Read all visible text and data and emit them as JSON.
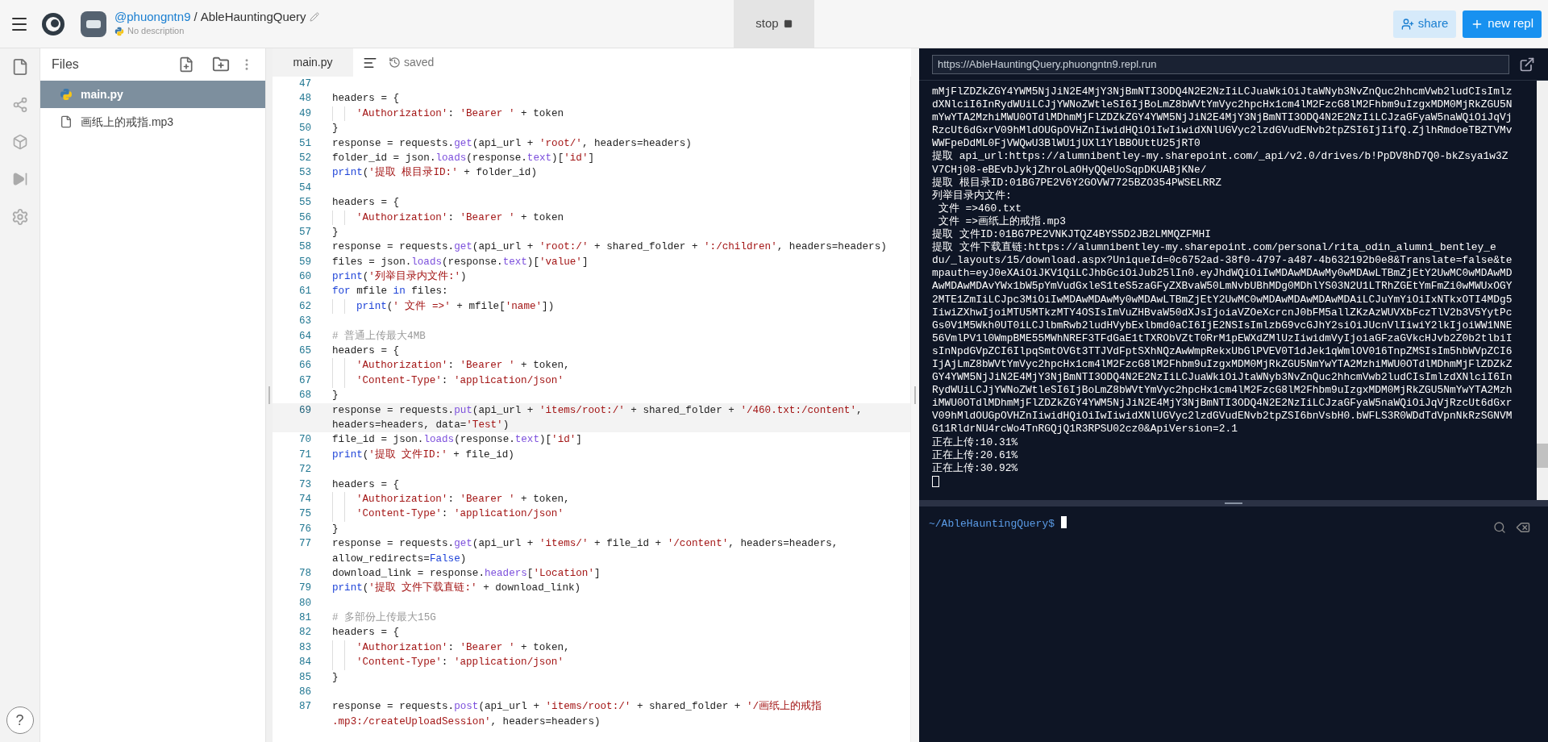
{
  "header": {
    "user": "@phuongntn9",
    "separator": "/",
    "repl_name": "AbleHauntingQuery",
    "description": "No description",
    "stop_button": "stop",
    "share_button": "share",
    "new_repl_button": "new repl"
  },
  "sidebar": {
    "help_button": "?"
  },
  "files": {
    "title": "Files",
    "items": [
      {
        "name": "main.py",
        "kind": "python",
        "selected": true
      },
      {
        "name": "画纸上的戒指.mp3",
        "kind": "file",
        "selected": false
      }
    ]
  },
  "editor": {
    "tab": "main.py",
    "status": "saved",
    "lines": [
      {
        "number": "47",
        "indented": false,
        "current": false
      },
      {
        "number": "48",
        "indented": false,
        "current": false,
        "rows": [
          {
            "segments": [
              {
                "text": "headers = {",
                "kind": "plain"
              }
            ]
          }
        ]
      },
      {
        "number": "49",
        "indented": true,
        "current": false,
        "rows": [
          {
            "segments": [
              {
                "text": "'Authorization'",
                "kind": "string"
              },
              {
                "text": ": ",
                "kind": "plain"
              },
              {
                "text": "'Bearer '",
                "kind": "string"
              },
              {
                "text": " + token",
                "kind": "plain"
              }
            ]
          }
        ]
      },
      {
        "number": "50",
        "indented": false,
        "current": false,
        "rows": [
          {
            "segments": [
              {
                "text": "}",
                "kind": "plain"
              }
            ]
          }
        ]
      },
      {
        "number": "51",
        "indented": false,
        "current": false,
        "rows": [
          {
            "segments": [
              {
                "text": "response = requests.",
                "kind": "plain"
              },
              {
                "text": "get",
                "kind": "member"
              },
              {
                "text": "(api_url + ",
                "kind": "plain"
              },
              {
                "text": "'root/'",
                "kind": "string"
              },
              {
                "text": ", headers=headers)",
                "kind": "plain"
              }
            ]
          }
        ]
      },
      {
        "number": "52",
        "indented": false,
        "current": false,
        "rows": [
          {
            "segments": [
              {
                "text": "folder_id = json.",
                "kind": "plain"
              },
              {
                "text": "loads",
                "kind": "member"
              },
              {
                "text": "(response.",
                "kind": "plain"
              },
              {
                "text": "text",
                "kind": "member"
              },
              {
                "text": ")[",
                "kind": "plain"
              },
              {
                "text": "'id'",
                "kind": "string"
              },
              {
                "text": "]",
                "kind": "plain"
              }
            ]
          }
        ]
      },
      {
        "number": "53",
        "indented": false,
        "current": false,
        "rows": [
          {
            "segments": [
              {
                "text": "print",
                "kind": "keyword"
              },
              {
                "text": "(",
                "kind": "plain"
              },
              {
                "text": "'提取 根目录ID:'",
                "kind": "string"
              },
              {
                "text": " + folder_id)",
                "kind": "plain"
              }
            ]
          }
        ]
      },
      {
        "number": "54",
        "indented": false,
        "current": false
      },
      {
        "number": "55",
        "indented": false,
        "current": false,
        "rows": [
          {
            "segments": [
              {
                "text": "headers = {",
                "kind": "plain"
              }
            ]
          }
        ]
      },
      {
        "number": "56",
        "indented": true,
        "current": false,
        "rows": [
          {
            "segments": [
              {
                "text": "'Authorization'",
                "kind": "string"
              },
              {
                "text": ": ",
                "kind": "plain"
              },
              {
                "text": "'Bearer '",
                "kind": "string"
              },
              {
                "text": " + token",
                "kind": "plain"
              }
            ]
          }
        ]
      },
      {
        "number": "57",
        "indented": false,
        "current": false,
        "rows": [
          {
            "segments": [
              {
                "text": "}",
                "kind": "plain"
              }
            ]
          }
        ]
      },
      {
        "number": "58",
        "indented": false,
        "current": false,
        "rows": [
          {
            "segments": [
              {
                "text": "response = requests.",
                "kind": "plain"
              },
              {
                "text": "get",
                "kind": "member"
              },
              {
                "text": "(api_url + ",
                "kind": "plain"
              },
              {
                "text": "'root:/'",
                "kind": "string"
              },
              {
                "text": " + shared_folder + ",
                "kind": "plain"
              },
              {
                "text": "':/children'",
                "kind": "string"
              },
              {
                "text": ", headers=headers)",
                "kind": "plain"
              }
            ]
          }
        ]
      },
      {
        "number": "59",
        "indented": false,
        "current": false,
        "rows": [
          {
            "segments": [
              {
                "text": "files = json.",
                "kind": "plain"
              },
              {
                "text": "loads",
                "kind": "member"
              },
              {
                "text": "(response.",
                "kind": "plain"
              },
              {
                "text": "text",
                "kind": "member"
              },
              {
                "text": ")[",
                "kind": "plain"
              },
              {
                "text": "'value'",
                "kind": "string"
              },
              {
                "text": "]",
                "kind": "plain"
              }
            ]
          }
        ]
      },
      {
        "number": "60",
        "indented": false,
        "current": false,
        "rows": [
          {
            "segments": [
              {
                "text": "print",
                "kind": "keyword"
              },
              {
                "text": "(",
                "kind": "plain"
              },
              {
                "text": "'列举目录内文件:'",
                "kind": "string"
              },
              {
                "text": ")",
                "kind": "plain"
              }
            ]
          }
        ]
      },
      {
        "number": "61",
        "indented": false,
        "current": false,
        "rows": [
          {
            "segments": [
              {
                "text": "for",
                "kind": "keyword"
              },
              {
                "text": " mfile ",
                "kind": "plain"
              },
              {
                "text": "in",
                "kind": "keyword"
              },
              {
                "text": " files:",
                "kind": "plain"
              }
            ]
          }
        ]
      },
      {
        "number": "62",
        "indented": true,
        "current": false,
        "rows": [
          {
            "segments": [
              {
                "text": "print",
                "kind": "keyword"
              },
              {
                "text": "(",
                "kind": "plain"
              },
              {
                "text": "' 文件 =>'",
                "kind": "string"
              },
              {
                "text": " + mfile[",
                "kind": "plain"
              },
              {
                "text": "'name'",
                "kind": "string"
              },
              {
                "text": "])",
                "kind": "plain"
              }
            ]
          }
        ]
      },
      {
        "number": "63",
        "indented": false,
        "current": false
      },
      {
        "number": "64",
        "indented": false,
        "current": false,
        "rows": [
          {
            "segments": [
              {
                "text": "# 普通上传最大4MB",
                "kind": "comment"
              }
            ]
          }
        ]
      },
      {
        "number": "65",
        "indented": false,
        "current": false,
        "rows": [
          {
            "segments": [
              {
                "text": "headers = {",
                "kind": "plain"
              }
            ]
          }
        ]
      },
      {
        "number": "66",
        "indented": true,
        "current": false,
        "rows": [
          {
            "segments": [
              {
                "text": "'Authorization'",
                "kind": "string"
              },
              {
                "text": ": ",
                "kind": "plain"
              },
              {
                "text": "'Bearer '",
                "kind": "string"
              },
              {
                "text": " + token,",
                "kind": "plain"
              }
            ]
          }
        ]
      },
      {
        "number": "67",
        "indented": true,
        "current": false,
        "rows": [
          {
            "segments": [
              {
                "text": "'Content-Type'",
                "kind": "string"
              },
              {
                "text": ": ",
                "kind": "plain"
              },
              {
                "text": "'application/json'",
                "kind": "string"
              }
            ]
          }
        ]
      },
      {
        "number": "68",
        "indented": false,
        "current": false,
        "rows": [
          {
            "segments": [
              {
                "text": "}",
                "kind": "plain"
              }
            ]
          }
        ]
      },
      {
        "number": "69",
        "indented": false,
        "current": true,
        "rows": [
          {
            "segments": [
              {
                "text": "response = requests.",
                "kind": "plain"
              },
              {
                "text": "put",
                "kind": "member"
              },
              {
                "text": "(api_url + ",
                "kind": "plain"
              },
              {
                "text": "'items/root:/'",
                "kind": "string"
              },
              {
                "text": " + shared_folder + ",
                "kind": "plain"
              },
              {
                "text": "'/460.txt:/content'",
                "kind": "string"
              },
              {
                "text": ",",
                "kind": "plain"
              }
            ]
          },
          {
            "segments": [
              {
                "text": "headers=headers, data=",
                "kind": "plain"
              },
              {
                "text": "'Test'",
                "kind": "string"
              },
              {
                "text": ")",
                "kind": "plain"
              }
            ]
          }
        ]
      },
      {
        "number": "70",
        "indented": false,
        "current": false,
        "rows": [
          {
            "segments": [
              {
                "text": "file_id = json.",
                "kind": "plain"
              },
              {
                "text": "loads",
                "kind": "member"
              },
              {
                "text": "(response.",
                "kind": "plain"
              },
              {
                "text": "text",
                "kind": "member"
              },
              {
                "text": ")[",
                "kind": "plain"
              },
              {
                "text": "'id'",
                "kind": "string"
              },
              {
                "text": "]",
                "kind": "plain"
              }
            ]
          }
        ]
      },
      {
        "number": "71",
        "indented": false,
        "current": false,
        "rows": [
          {
            "segments": [
              {
                "text": "print",
                "kind": "keyword"
              },
              {
                "text": "(",
                "kind": "plain"
              },
              {
                "text": "'提取 文件ID:'",
                "kind": "string"
              },
              {
                "text": " + file_id)",
                "kind": "plain"
              }
            ]
          }
        ]
      },
      {
        "number": "72",
        "indented": false,
        "current": false
      },
      {
        "number": "73",
        "indented": false,
        "current": false,
        "rows": [
          {
            "segments": [
              {
                "text": "headers = {",
                "kind": "plain"
              }
            ]
          }
        ]
      },
      {
        "number": "74",
        "indented": true,
        "current": false,
        "rows": [
          {
            "segments": [
              {
                "text": "'Authorization'",
                "kind": "string"
              },
              {
                "text": ": ",
                "kind": "plain"
              },
              {
                "text": "'Bearer '",
                "kind": "string"
              },
              {
                "text": " + token,",
                "kind": "plain"
              }
            ]
          }
        ]
      },
      {
        "number": "75",
        "indented": true,
        "current": false,
        "rows": [
          {
            "segments": [
              {
                "text": "'Content-Type'",
                "kind": "string"
              },
              {
                "text": ": ",
                "kind": "plain"
              },
              {
                "text": "'application/json'",
                "kind": "string"
              }
            ]
          }
        ]
      },
      {
        "number": "76",
        "indented": false,
        "current": false,
        "rows": [
          {
            "segments": [
              {
                "text": "}",
                "kind": "plain"
              }
            ]
          }
        ]
      },
      {
        "number": "77",
        "indented": false,
        "current": false,
        "rows": [
          {
            "segments": [
              {
                "text": "response = requests.",
                "kind": "plain"
              },
              {
                "text": "get",
                "kind": "member"
              },
              {
                "text": "(api_url + ",
                "kind": "plain"
              },
              {
                "text": "'items/'",
                "kind": "string"
              },
              {
                "text": " + file_id + ",
                "kind": "plain"
              },
              {
                "text": "'/content'",
                "kind": "string"
              },
              {
                "text": ", headers=headers,",
                "kind": "plain"
              }
            ]
          },
          {
            "segments": [
              {
                "text": "allow_redirects=",
                "kind": "plain"
              },
              {
                "text": "False",
                "kind": "keyword"
              },
              {
                "text": ")",
                "kind": "plain"
              }
            ]
          }
        ]
      },
      {
        "number": "78",
        "indented": false,
        "current": false,
        "rows": [
          {
            "segments": [
              {
                "text": "download_link = response.",
                "kind": "plain"
              },
              {
                "text": "headers",
                "kind": "member"
              },
              {
                "text": "[",
                "kind": "plain"
              },
              {
                "text": "'Location'",
                "kind": "string"
              },
              {
                "text": "]",
                "kind": "plain"
              }
            ]
          }
        ]
      },
      {
        "number": "79",
        "indented": false,
        "current": false,
        "rows": [
          {
            "segments": [
              {
                "text": "print",
                "kind": "keyword"
              },
              {
                "text": "(",
                "kind": "plain"
              },
              {
                "text": "'提取 文件下载直链:'",
                "kind": "string"
              },
              {
                "text": " + download_link)",
                "kind": "plain"
              }
            ]
          }
        ]
      },
      {
        "number": "80",
        "indented": false,
        "current": false
      },
      {
        "number": "81",
        "indented": false,
        "current": false,
        "rows": [
          {
            "segments": [
              {
                "text": "# 多部份上传最大15G",
                "kind": "comment"
              }
            ]
          }
        ]
      },
      {
        "number": "82",
        "indented": false,
        "current": false,
        "rows": [
          {
            "segments": [
              {
                "text": "headers = {",
                "kind": "plain"
              }
            ]
          }
        ]
      },
      {
        "number": "83",
        "indented": true,
        "current": false,
        "rows": [
          {
            "segments": [
              {
                "text": "'Authorization'",
                "kind": "string"
              },
              {
                "text": ": ",
                "kind": "plain"
              },
              {
                "text": "'Bearer '",
                "kind": "string"
              },
              {
                "text": " + token,",
                "kind": "plain"
              }
            ]
          }
        ]
      },
      {
        "number": "84",
        "indented": true,
        "current": false,
        "rows": [
          {
            "segments": [
              {
                "text": "'Content-Type'",
                "kind": "string"
              },
              {
                "text": ": ",
                "kind": "plain"
              },
              {
                "text": "'application/json'",
                "kind": "string"
              }
            ]
          }
        ]
      },
      {
        "number": "85",
        "indented": false,
        "current": false,
        "rows": [
          {
            "segments": [
              {
                "text": "}",
                "kind": "plain"
              }
            ]
          }
        ]
      },
      {
        "number": "86",
        "indented": false,
        "current": false
      },
      {
        "number": "87",
        "indented": false,
        "current": false,
        "rows": [
          {
            "segments": [
              {
                "text": "response = requests.",
                "kind": "plain"
              },
              {
                "text": "post",
                "kind": "member"
              },
              {
                "text": "(api_url + ",
                "kind": "plain"
              },
              {
                "text": "'items/root:/'",
                "kind": "string"
              },
              {
                "text": " + shared_folder + ",
                "kind": "plain"
              },
              {
                "text": "'/画纸上的戒指",
                "kind": "string"
              }
            ]
          },
          {
            "segments": [
              {
                "text": ".mp3:/createUploadSession'",
                "kind": "string"
              },
              {
                "text": ", headers=headers)",
                "kind": "plain"
              }
            ]
          }
        ]
      }
    ]
  },
  "webview": {
    "url": "https://AbleHauntingQuery.phuongntn9.repl.run"
  },
  "console": {
    "lines": [
      "mMjFlZDZkZGY4YWM5NjJiN2E4MjY3NjBmNTI3ODQ4N2E2NzIiLCJuaWkiOiJtaWNyb3NvZnQuc2hhcmVwb2ludCIsImlz",
      "dXNlciI6InRydWUiLCJjYWNoZWtleSI6IjBoLmZ8bWVtYmVyc2hpcHx1cm4lM2FzcG8lM2Fhbm9uIzgxMDM0MjRkZGU5N",
      "mYwYTA2MzhiMWU0OTdlMDhmMjFlZDZkZGY4YWM5NjJiN2E4MjY3NjBmNTI3ODQ4N2E2NzIiLCJzaGFyaW5naWQiOiJqVj",
      "RzcUt6dGxrV09hMldOUGpOVHZnIiwidHQiOiIwIiwidXNlUGVyc2lzdGVudENvb2tpZSI6IjIifQ.ZjlhRmdoeTBZTVMv",
      "WWFpeDdML0FjVWQwU3BlWU1jUXl1YlBBOUttU25jRT0",
      "提取 api_url:https://alumnibentley-my.sharepoint.com/_api/v2.0/drives/b!PpDV8hD7Q0-bkZsya1w3Z",
      "V7CHj08-eBEvbJykjZhroLaOHyQQeUoSqpDKUABjKNe/",
      "提取 根目录ID:01BG7PE2V6Y2GOVW7725BZO354PWSELRRZ",
      "列举目录内文件:",
      " 文件 =>460.txt",
      " 文件 =>画纸上的戒指.mp3",
      "提取 文件ID:01BG7PE2VNKJTQZ4BYS5D2JB2LMMQZFMHI",
      "提取 文件下载直链:https://alumnibentley-my.sharepoint.com/personal/rita_odin_alumni_bentley_e",
      "du/_layouts/15/download.aspx?UniqueId=0c6752ad-38f0-4797-a487-4b632192b0e8&Translate=false&te",
      "mpauth=eyJ0eXAiOiJKV1QiLCJhbGciOiJub25lIn0.eyJhdWQiOiIwMDAwMDAwMy0wMDAwLTBmZjEtY2UwMC0wMDAwMD",
      "AwMDAwMDAvYWx1bW5pYmVudGxleS1teS5zaGFyZXBvaW50LmNvbUBhMDg0MDhlYS03N2U1LTRhZGEtYmFmZi0wMWUxOGY",
      "2MTE1ZmIiLCJpc3MiOiIwMDAwMDAwMy0wMDAwLTBmZjEtY2UwMC0wMDAwMDAwMDAwMDAiLCJuYmYiOiIxNTkxOTI4MDg5",
      "IiwiZXhwIjoiMTU5MTkzMTY4OSIsImVuZHBvaW50dXJsIjoiaVZOeXcrcnJ0bFM5allZKzAzWUVXbFczTlV2b3V5YytPc",
      "Gs0V1M5Wkh0UT0iLCJlbmRwb2ludHVybExlbmd0aCI6IjE2NSIsImlzbG9vcGJhY2siOiJUcnVlIiwiY2lkIjoiWW1NNE",
      "56VmlPV1l0WmpBME55MWhNREF3TFdGaE1tTXRObVZtT0RrM1pEWXdZMlUzIiwidmVyIjoiaGFzaGVkcHJvb2Z0b2tlbiI",
      "sInNpdGVpZCI6IlpqSmtOVGt3TTJVdFptSXhNQzAwWmpRekxUbGlPVEV0T1dJek1qWmlOV016TnpZMSIsIm5hbWVpZCI6",
      "IjAjLmZ8bWVtYmVyc2hpcHx1cm4lM2FzcG8lM2Fhbm9uIzgxMDM0MjRkZGU5NmYwYTA2MzhiMWU0OTdlMDhmMjFlZDZkZ",
      "GY4YWM5NjJiN2E4MjY3NjBmNTI3ODQ4N2E2NzIiLCJuaWkiOiJtaWNyb3NvZnQuc2hhcmVwb2ludCIsImlzdXNlciI6In",
      "RydWUiLCJjYWNoZWtleSI6IjBoLmZ8bWVtYmVyc2hpcHx1cm4lM2FzcG8lM2Fhbm9uIzgxMDM0MjRkZGU5NmYwYTA2Mzh",
      "iMWU0OTdlMDhmMjFlZDZkZGY4YWM5NjJiN2E4MjY3NjBmNTI3ODQ4N2E2NzIiLCJzaGFyaW5naWQiOiJqVjRzcUt6dGxr",
      "V09hMldOUGpOVHZnIiwidHQiOiIwIiwidXNlUGVyc2lzdGVudENvb2tpZSI6bnVsbH0.bWFLS3R0WDdTdVpnNkRzSGNVM",
      "G11RldrNU4rcWo4TnRGQjQ1R3RPSU02cz0&ApiVersion=2.1",
      "正在上传:10.31%",
      "正在上传:20.61%",
      "正在上传:30.92%"
    ]
  },
  "shell": {
    "prompt": "~/AbleHauntingQuery$"
  }
}
